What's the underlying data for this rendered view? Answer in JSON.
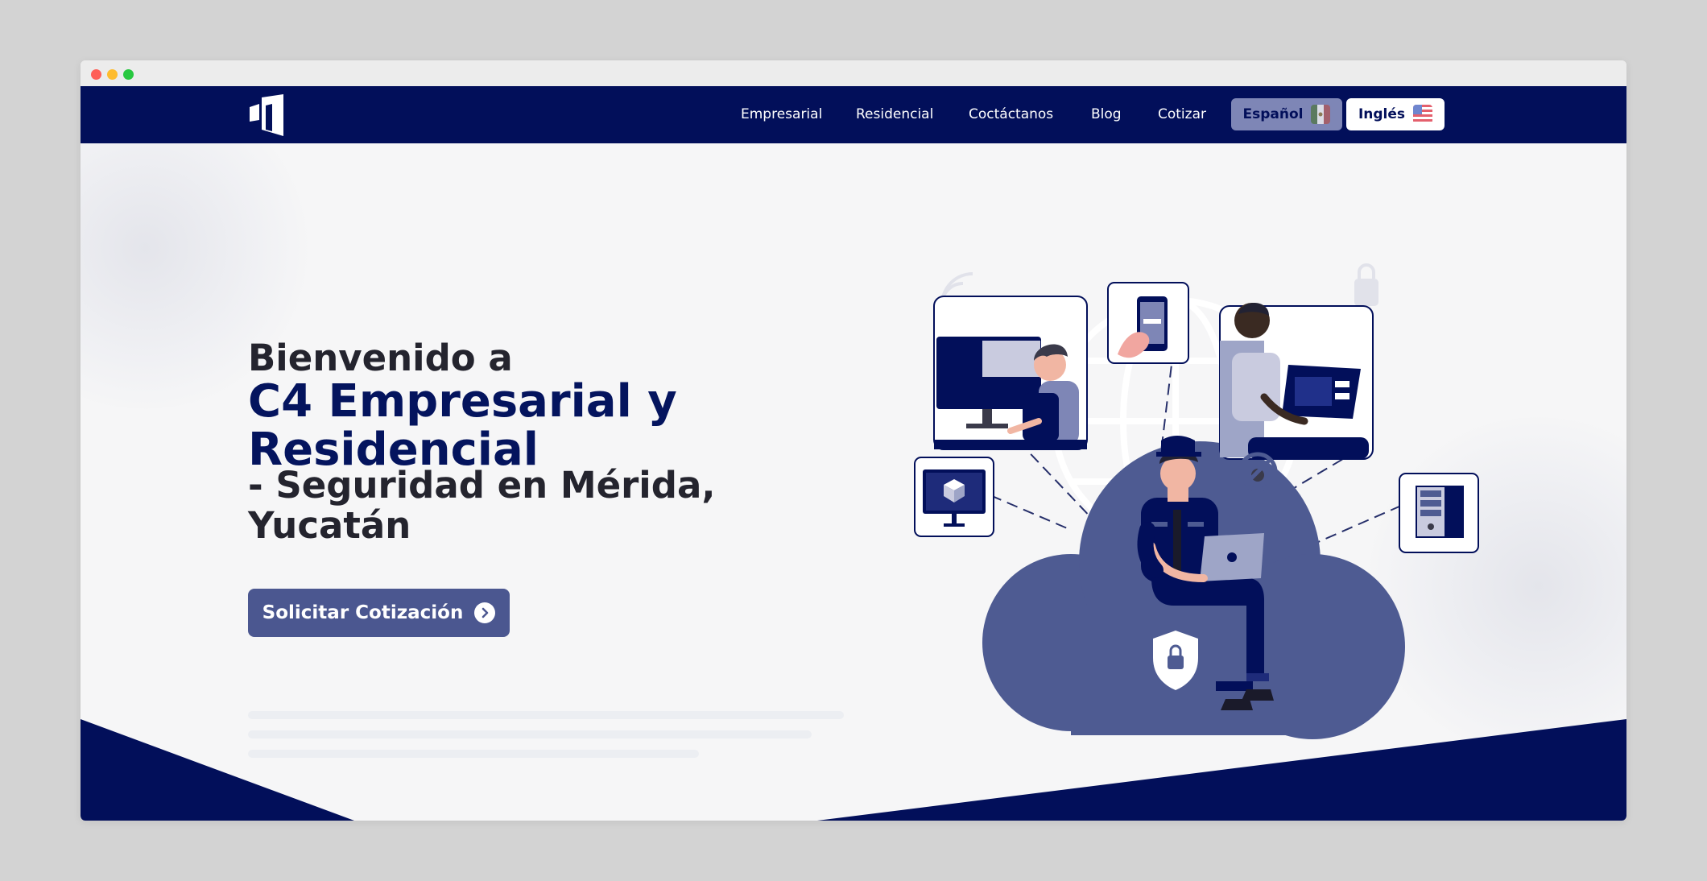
{
  "nav": {
    "logo": "building-logo-icon",
    "links": [
      "Empresarial",
      "Residencial",
      "Coctáctanos",
      "Blog",
      "Cotizar"
    ],
    "lang_es": {
      "label": "Español",
      "flag": "mexico-flag-icon"
    },
    "lang_en": {
      "label": "Inglés",
      "flag": "usa-flag-icon"
    }
  },
  "hero": {
    "line1": "Bienvenido a",
    "line2": "C4 Empresarial y Residencial",
    "line3": "- Seguridad en Mérida, Yucatán",
    "cta_label": "Solicitar Cotización",
    "cta_icon": "chevron-right-circle-icon"
  },
  "colors": {
    "navy": "#020f5a",
    "cta": "#4b5790",
    "cloud": "#4e5b92",
    "text_dark": "#24242e"
  }
}
